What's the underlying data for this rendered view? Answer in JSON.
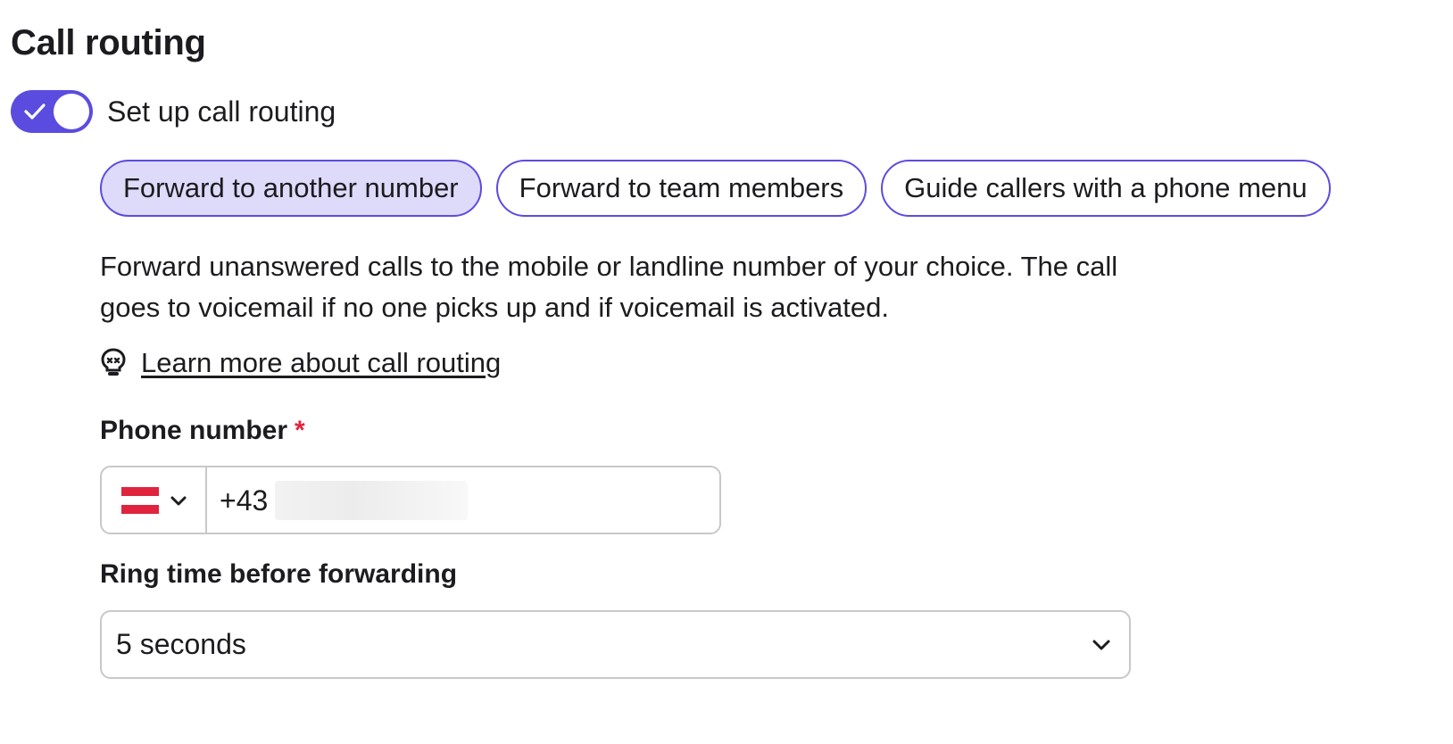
{
  "section": {
    "title": "Call routing"
  },
  "toggle": {
    "label": "Set up call routing",
    "checked": true,
    "color": "#5b4ce0"
  },
  "routing_options": [
    {
      "label": "Forward to another number",
      "selected": true
    },
    {
      "label": "Forward to team members",
      "selected": false
    },
    {
      "label": "Guide callers with a phone menu",
      "selected": false
    }
  ],
  "description": "Forward unanswered calls to the mobile or landline number of your choice. The call goes to voicemail if no one picks up and if voicemail is activated.",
  "learn_more": {
    "icon": "lightbulb-icon",
    "label": "Learn more about call routing"
  },
  "phone": {
    "label": "Phone number",
    "required_mark": "*",
    "country_flag": "austria-flag",
    "dial_prefix": "+43"
  },
  "ring_time": {
    "label": "Ring time before forwarding",
    "value": "5 seconds"
  },
  "colors": {
    "accent": "#5b4ce0",
    "selected_chip_bg": "#dedafa",
    "required": "#e0243d",
    "border": "#c8c8cc"
  }
}
